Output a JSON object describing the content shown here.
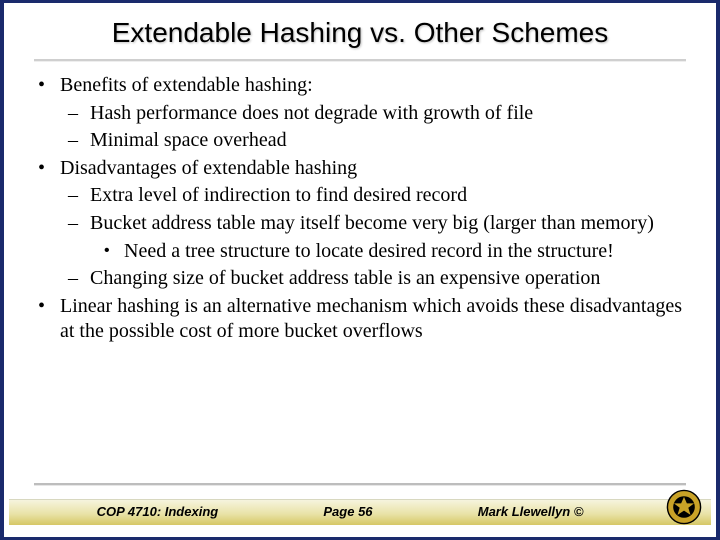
{
  "title": "Extendable Hashing vs. Other Schemes",
  "bullets": {
    "benefits_label": "Benefits of extendable hashing:",
    "benefit1": "Hash performance does not degrade with growth of file",
    "benefit2": "Minimal space overhead",
    "disadvantages_label": "Disadvantages of extendable hashing",
    "dis1": "Extra level of indirection to find desired record",
    "dis2": "Bucket address table may itself become very big (larger than memory)",
    "dis2a": "Need a tree structure to locate desired record in the structure!",
    "dis3": "Changing size of bucket address table is an expensive operation",
    "linear": "Linear hashing is an alternative mechanism which avoids these disadvantages at the possible cost of more bucket overflows"
  },
  "footer": {
    "left": "COP 4710: Indexing",
    "center": "Page 56",
    "right": "Mark Llewellyn ©"
  }
}
